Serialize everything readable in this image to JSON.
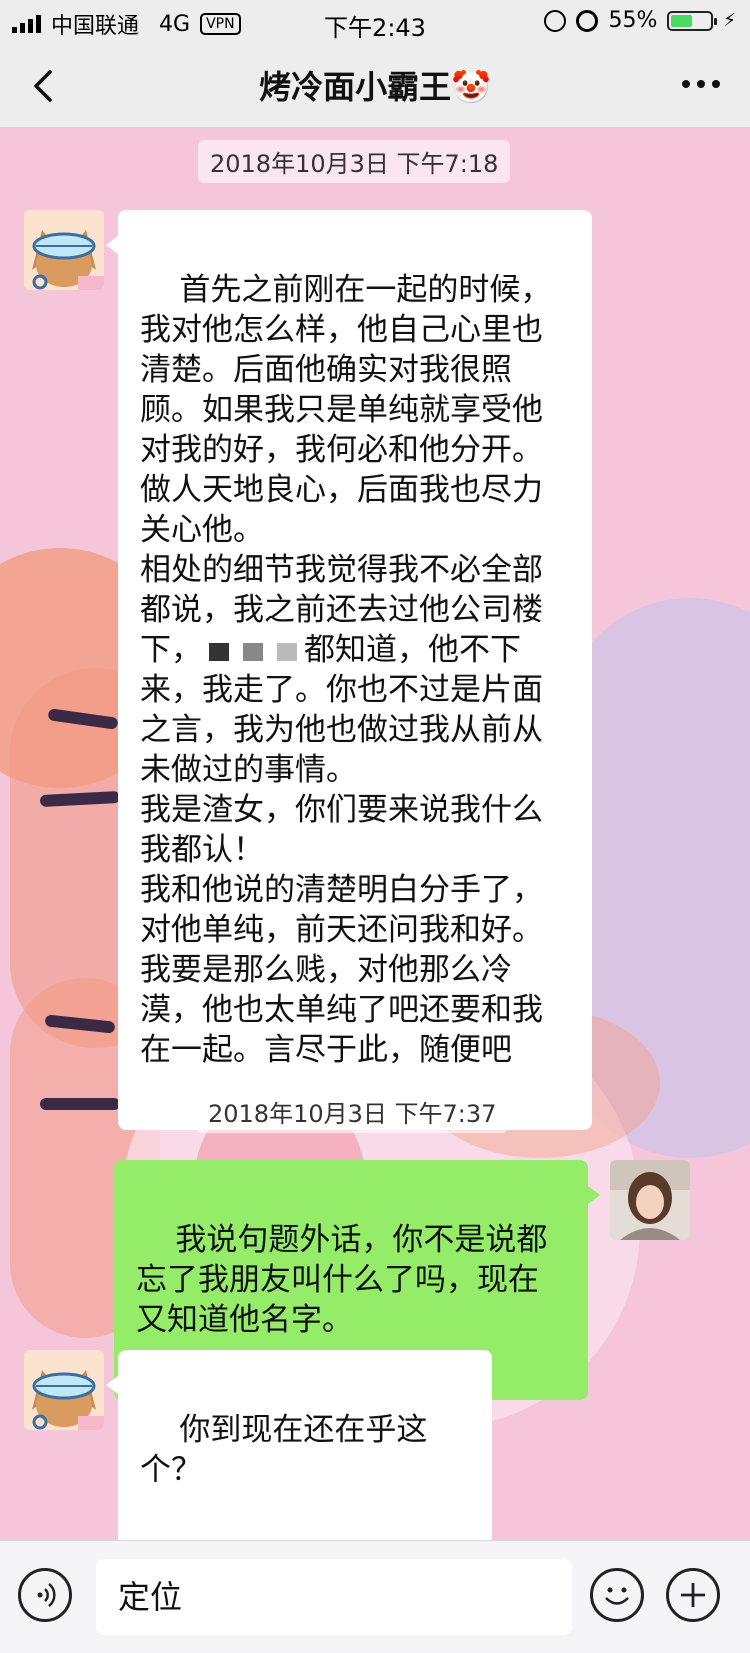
{
  "status_bar": {
    "carrier": "中国联通",
    "network": "4G",
    "vpn": "VPN",
    "time": "下午2:43",
    "battery_percent": "55%",
    "battery_level": 0.55
  },
  "nav": {
    "back_icon": "chevron-left-icon",
    "title": "烤冷面小霸王🤡",
    "more_icon": "more-dots-icon"
  },
  "messages": {
    "ts1": "2018年10月3日 下午7:18",
    "m1_line1": "首先之前刚在一起的时候，我对他怎么样，他自己心里也清楚。后面他确实对我很照顾。如果我只是单纯就享受他对我的好，我何必和他分开。做人天地良心，后面我也尽力关心他。\n相处的细节我觉得我不必全部都说，我之前还去过他公司楼下，",
    "m1_redacted_suffix": "都知道，他不下来，我走了。你也不过是片面之言，我为他也做过我从前从未做过的事情。\n我是渣女，你们要来说我什么我都认！\n我和他说的清楚明白分手了，对他单纯，前天还问我和好。我要是那么贱，对他那么冷漠，他也太单纯了吧还要和我在一起。言尽于此，随便吧",
    "ts2": "2018年10月3日 下午7:37",
    "m2": "我说句题外话，你不是说都忘了我朋友叫什么了吗，现在又知道他名字。",
    "m3": "你到现在还在乎这个？"
  },
  "input_bar": {
    "voice_icon": "voice-icon",
    "text": "定位",
    "emoji_icon": "emoji-icon",
    "plus_icon": "plus-icon"
  },
  "colors": {
    "outgoing_bubble": "#95ec69",
    "incoming_bubble": "#ffffff",
    "chat_background": "#f5c6da",
    "bar_background": "#ededed"
  }
}
